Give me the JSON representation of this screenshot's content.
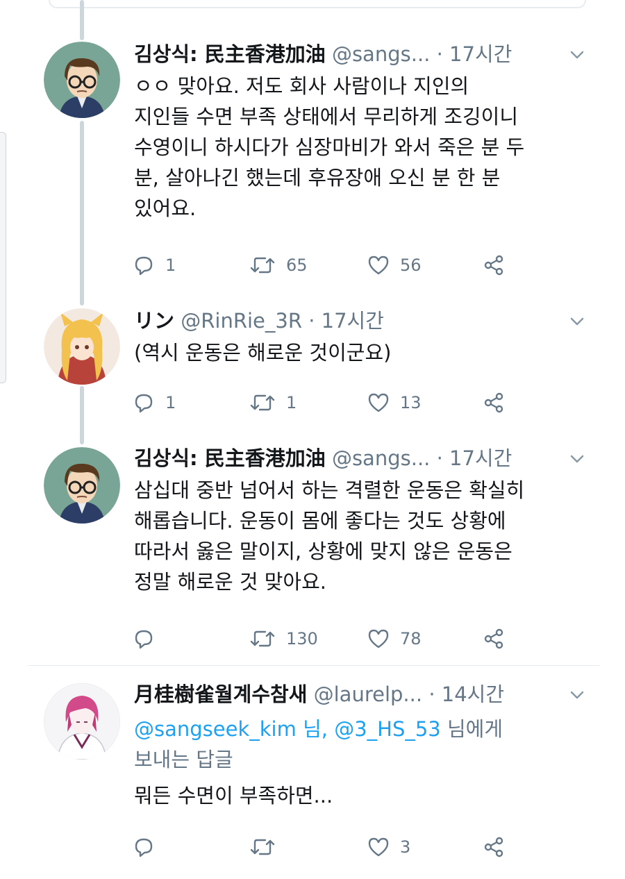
{
  "colors": {
    "accent": "#1da1f2",
    "text": "#14171a",
    "muted": "#657786",
    "thread_line": "#ccd6dd"
  },
  "tweets": [
    {
      "author": "김상식: 民主香港加油",
      "handle": "@sangs...",
      "time": "17시간",
      "body": "ㅇㅇ 맞아요. 저도 회사 사람이나 지인의\n지인들 수면 부족 상태에서 무리하게 조깅이니\n수영이니 하시다가 심장마비가 와서 죽은 분 두\n분, 살아나긴 했는데 후유장애 오신 분 한 분\n있어요.",
      "replies": "1",
      "retweets": "65",
      "likes": "56"
    },
    {
      "author": "リン",
      "handle": "@RinRie_3R",
      "time": "17시간",
      "body": "(역시 운동은 해로운 것이군요)",
      "replies": "1",
      "retweets": "1",
      "likes": "13"
    },
    {
      "author": "김상식: 民主香港加油",
      "handle": "@sangs...",
      "time": "17시간",
      "body": "삼십대 중반 넘어서 하는 격렬한 운동은 확실히\n해롭습니다. 운동이 몸에 좋다는 것도 상황에\n따라서 옳은 말이지, 상황에 맞지 않은 운동은\n정말 해로운 것 맞아요.",
      "replies": "",
      "retweets": "130",
      "likes": "78"
    },
    {
      "author": "月桂樹雀월계수참새",
      "handle": "@laurelp...",
      "time": "14시간",
      "reply_mentions": "@sangseek_kim 님, @3_HS_53",
      "reply_suffix": " 님에게",
      "reply_line2": "보내는 답글",
      "body": "뭐든 수면이 부족하면...",
      "replies": "",
      "retweets": "",
      "likes": "3"
    }
  ],
  "icons": {
    "reply": "reply-icon",
    "retweet": "retweet-icon",
    "like": "heart-icon",
    "share": "share-icon",
    "more": "chevron-down-icon"
  }
}
